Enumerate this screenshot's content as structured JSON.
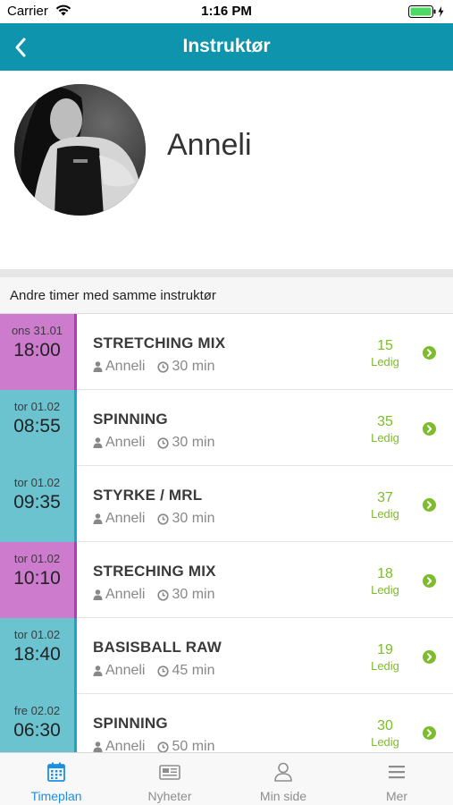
{
  "status": {
    "carrier": "Carrier",
    "time": "1:16 PM"
  },
  "nav": {
    "title": "Instruktør"
  },
  "profile": {
    "name": "Anneli"
  },
  "section": {
    "header": "Andre timer med samme instruktør"
  },
  "classes": [
    {
      "day": "ons 31.01",
      "time": "18:00",
      "title": "STRETCHING MIX",
      "instructor": "Anneli",
      "duration": "30 min",
      "spots": "15",
      "spots_label": "Ledig",
      "color": "magenta"
    },
    {
      "day": "tor 01.02",
      "time": "08:55",
      "title": "SPINNING",
      "instructor": "Anneli",
      "duration": "30 min",
      "spots": "35",
      "spots_label": "Ledig",
      "color": "teal"
    },
    {
      "day": "tor 01.02",
      "time": "09:35",
      "title": "STYRKE / MRL",
      "instructor": "Anneli",
      "duration": "30 min",
      "spots": "37",
      "spots_label": "Ledig",
      "color": "teal"
    },
    {
      "day": "tor 01.02",
      "time": "10:10",
      "title": "STRECHING MIX",
      "instructor": "Anneli",
      "duration": "30 min",
      "spots": "18",
      "spots_label": "Ledig",
      "color": "magenta"
    },
    {
      "day": "tor 01.02",
      "time": "18:40",
      "title": "BASISBALL RAW",
      "instructor": "Anneli",
      "duration": "45 min",
      "spots": "19",
      "spots_label": "Ledig",
      "color": "teal"
    },
    {
      "day": "fre 02.02",
      "time": "06:30",
      "title": "SPINNING",
      "instructor": "Anneli",
      "duration": "50 min",
      "spots": "30",
      "spots_label": "Ledig",
      "color": "teal"
    }
  ],
  "tabs": [
    {
      "label": "Timeplan",
      "icon": "calendar-icon",
      "active": true
    },
    {
      "label": "Nyheter",
      "icon": "newspaper-icon",
      "active": false
    },
    {
      "label": "Min side",
      "icon": "user-icon",
      "active": false
    },
    {
      "label": "Mer",
      "icon": "menu-icon",
      "active": false
    }
  ],
  "colors": {
    "nav": "#0f94ad",
    "magenta": "#cd7bcd",
    "teal": "#6bc3d0",
    "available": "#7dbc2a",
    "tab_active": "#1b8fe3"
  }
}
